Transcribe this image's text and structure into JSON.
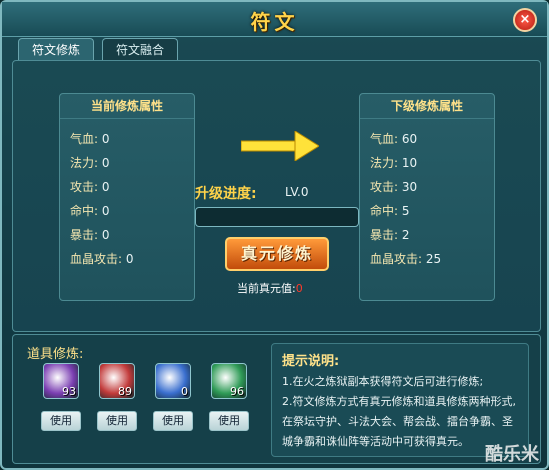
{
  "window": {
    "title": "符文",
    "close_icon": "close-icon"
  },
  "tabs": [
    {
      "label": "符文修炼"
    },
    {
      "label": "符文融合"
    }
  ],
  "current_attributes": {
    "title": "当前修炼属性",
    "rows": [
      {
        "label": "气血:",
        "value": "0"
      },
      {
        "label": "法力:",
        "value": "0"
      },
      {
        "label": "攻击:",
        "value": "0"
      },
      {
        "label": "命中:",
        "value": "0"
      },
      {
        "label": "暴击:",
        "value": "0"
      },
      {
        "label": "血晶攻击:",
        "value": "0"
      }
    ]
  },
  "next_attributes": {
    "title": "下级修炼属性",
    "rows": [
      {
        "label": "气血:",
        "value": "60"
      },
      {
        "label": "法力:",
        "value": "10"
      },
      {
        "label": "攻击:",
        "value": "30"
      },
      {
        "label": "命中:",
        "value": "5"
      },
      {
        "label": "暴击:",
        "value": "2"
      },
      {
        "label": "血晶攻击:",
        "value": "25"
      }
    ]
  },
  "upgrade": {
    "label": "升级进度:",
    "level": "LV.0",
    "progress": 0,
    "button_label": "真元修炼",
    "current_label": "当前真元值:",
    "current_value": "0"
  },
  "items_section": {
    "title": "道具修炼:",
    "items": [
      {
        "name": "purple-gem-icon",
        "count": "93",
        "color": "#7b3fb2",
        "use_label": "使用"
      },
      {
        "name": "red-gem-icon",
        "count": "89",
        "color": "#c23b3b",
        "use_label": "使用"
      },
      {
        "name": "blue-rune-icon",
        "count": "0",
        "color": "#3a6fcf",
        "use_label": "使用"
      },
      {
        "name": "green-crystal-icon",
        "count": "96",
        "color": "#2f9b57",
        "use_label": "使用"
      }
    ]
  },
  "tips": {
    "title": "提示说明:",
    "lines": [
      "1.在火之炼狱副本获得符文后可进行修炼;",
      "2.符文修炼方式有真元修炼和道具修炼两种形式,在祭坛守护、斗法大会、帮会战、擂台争霸、圣城争霸和诛仙阵等活动中可获得真元。"
    ]
  },
  "watermark": "酷乐米"
}
